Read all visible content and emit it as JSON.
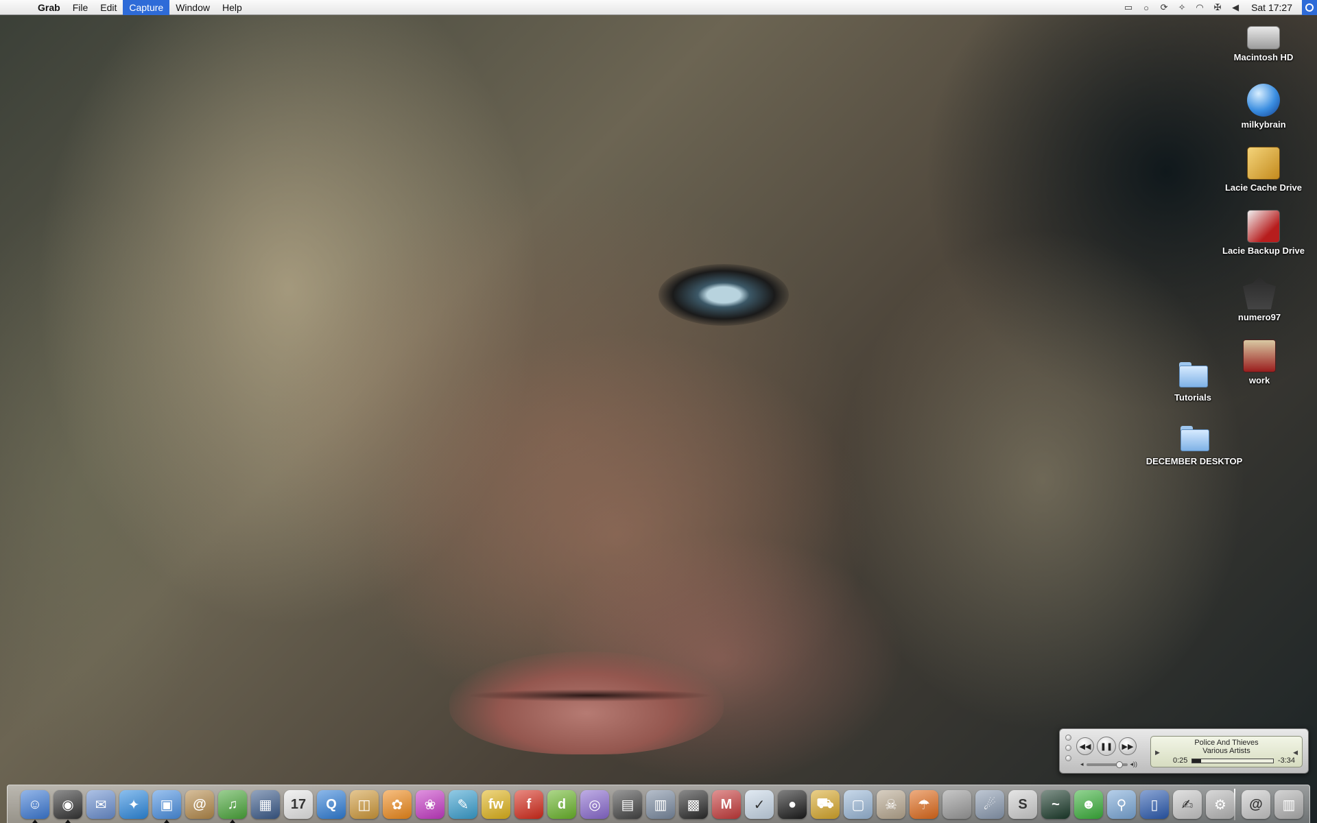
{
  "menubar": {
    "apple": "",
    "app_name": "Grab",
    "items": [
      "File",
      "Edit",
      "Capture",
      "Window",
      "Help"
    ],
    "active_item": "Capture",
    "clock": "Sat 17:27",
    "status_icons": [
      "display-icon",
      "chat-icon",
      "sync-icon",
      "bluetooth-icon",
      "wifi-icon",
      "flag-uk-icon",
      "volume-icon"
    ]
  },
  "desktop": {
    "icons": [
      {
        "label": "Macintosh HD",
        "icon": "hard-drive-icon"
      },
      {
        "label": "milkybrain",
        "icon": "network-globe-icon"
      },
      {
        "label": "Lacie Cache Drive",
        "icon": "external-drive-icon"
      },
      {
        "label": "Lacie Backup Drive",
        "icon": "external-drive-icon"
      },
      {
        "label": "numero97",
        "icon": "batman-icon"
      },
      {
        "label": "work",
        "icon": "drive-icon"
      },
      {
        "label": "Tutorials",
        "icon": "folder-icon"
      },
      {
        "label": "DECEMBER DESKTOP",
        "icon": "folder-icon"
      }
    ]
  },
  "mini_player": {
    "song": "Police And Thieves",
    "artist": "Various Artists",
    "elapsed": "0:25",
    "remaining": "-3:34",
    "progress": 0.11,
    "volume": 0.8,
    "state": "playing"
  },
  "dock": {
    "items": [
      {
        "name": "finder",
        "glyph": "☺",
        "color": "#3c7ad6",
        "running": true
      },
      {
        "name": "dashboard",
        "glyph": "◉",
        "color": "#333333",
        "running": true
      },
      {
        "name": "mail-stamp",
        "glyph": "✉",
        "color": "#6a8fd0",
        "running": false
      },
      {
        "name": "safari",
        "glyph": "✦",
        "color": "#2d8ae0",
        "running": false
      },
      {
        "name": "ichat",
        "glyph": "▣",
        "color": "#4a90e2",
        "running": true
      },
      {
        "name": "address-book",
        "glyph": "@",
        "color": "#b58a4a",
        "running": false
      },
      {
        "name": "itunes",
        "glyph": "♫",
        "color": "#4aa73a",
        "running": true
      },
      {
        "name": "iphoto",
        "glyph": "▦",
        "color": "#3a5a8a",
        "running": false
      },
      {
        "name": "ical",
        "glyph": "17",
        "color": "#e8e8e8",
        "running": false
      },
      {
        "name": "quicktime",
        "glyph": "Q",
        "color": "#2f7ed8",
        "running": false
      },
      {
        "name": "preview",
        "glyph": "◫",
        "color": "#d09a3a",
        "running": false
      },
      {
        "name": "flower-app",
        "glyph": "✿",
        "color": "#f08a1a",
        "running": false
      },
      {
        "name": "flower-app-2",
        "glyph": "❀",
        "color": "#c63ac6",
        "running": false
      },
      {
        "name": "feather-app",
        "glyph": "✎",
        "color": "#3aa0d0",
        "running": false
      },
      {
        "name": "fireworks",
        "glyph": "fw",
        "color": "#e0b41a",
        "running": false
      },
      {
        "name": "flash",
        "glyph": "f",
        "color": "#d62a1a",
        "running": false
      },
      {
        "name": "dreamweaver",
        "glyph": "d",
        "color": "#6ab62a",
        "running": false
      },
      {
        "name": "dvd-player",
        "glyph": "◎",
        "color": "#8a6ad0",
        "running": false
      },
      {
        "name": "final-cut",
        "glyph": "▤",
        "color": "#444444",
        "running": false
      },
      {
        "name": "printer-app",
        "glyph": "▥",
        "color": "#7a8aa0",
        "running": false
      },
      {
        "name": "motion-app",
        "glyph": "▩",
        "color": "#2a2a2a",
        "running": false
      },
      {
        "name": "mac-the-ripper",
        "glyph": "M",
        "color": "#c63a3a",
        "running": false
      },
      {
        "name": "script-editor",
        "glyph": "✓",
        "color": "#c8d8e8",
        "running": false
      },
      {
        "name": "camera-app",
        "glyph": "●",
        "color": "#1a1a1a",
        "running": false
      },
      {
        "name": "transmit",
        "glyph": "⛟",
        "color": "#d8a82a",
        "running": false
      },
      {
        "name": "package-app",
        "glyph": "▢",
        "color": "#9ab8d8",
        "running": false
      },
      {
        "name": "skull-app",
        "glyph": "☠",
        "color": "#b8a890",
        "running": false
      },
      {
        "name": "umbrella-app",
        "glyph": "☂",
        "color": "#e06a1a",
        "running": false
      },
      {
        "name": "system-preferences",
        "glyph": "",
        "color": "#9a9a9a",
        "running": false
      },
      {
        "name": "dashboard-skate",
        "glyph": "☄",
        "color": "#8a9ab0",
        "running": false
      },
      {
        "name": "s2p-app",
        "glyph": "S",
        "color": "#d0d0d0",
        "running": false
      },
      {
        "name": "activity-monitor",
        "glyph": "~",
        "color": "#1a3a2a",
        "running": false
      },
      {
        "name": "alien-app",
        "glyph": "☻",
        "color": "#3ab03a",
        "running": false
      },
      {
        "name": "finder-search",
        "glyph": "⚲",
        "color": "#7aa8d8",
        "running": false
      },
      {
        "name": "books-app",
        "glyph": "▯",
        "color": "#2a5ab0",
        "running": false
      },
      {
        "name": "paper-app",
        "glyph": "✍",
        "color": "#c8c8c8",
        "running": false
      },
      {
        "name": "migration-app",
        "glyph": "⚙",
        "color": "#b8b8b8",
        "running": false
      }
    ],
    "right_items": [
      {
        "name": "mail-folder",
        "glyph": "@",
        "color": "#c8c8c8"
      },
      {
        "name": "trash",
        "glyph": "▥",
        "color": "#b0b0b0"
      }
    ]
  }
}
